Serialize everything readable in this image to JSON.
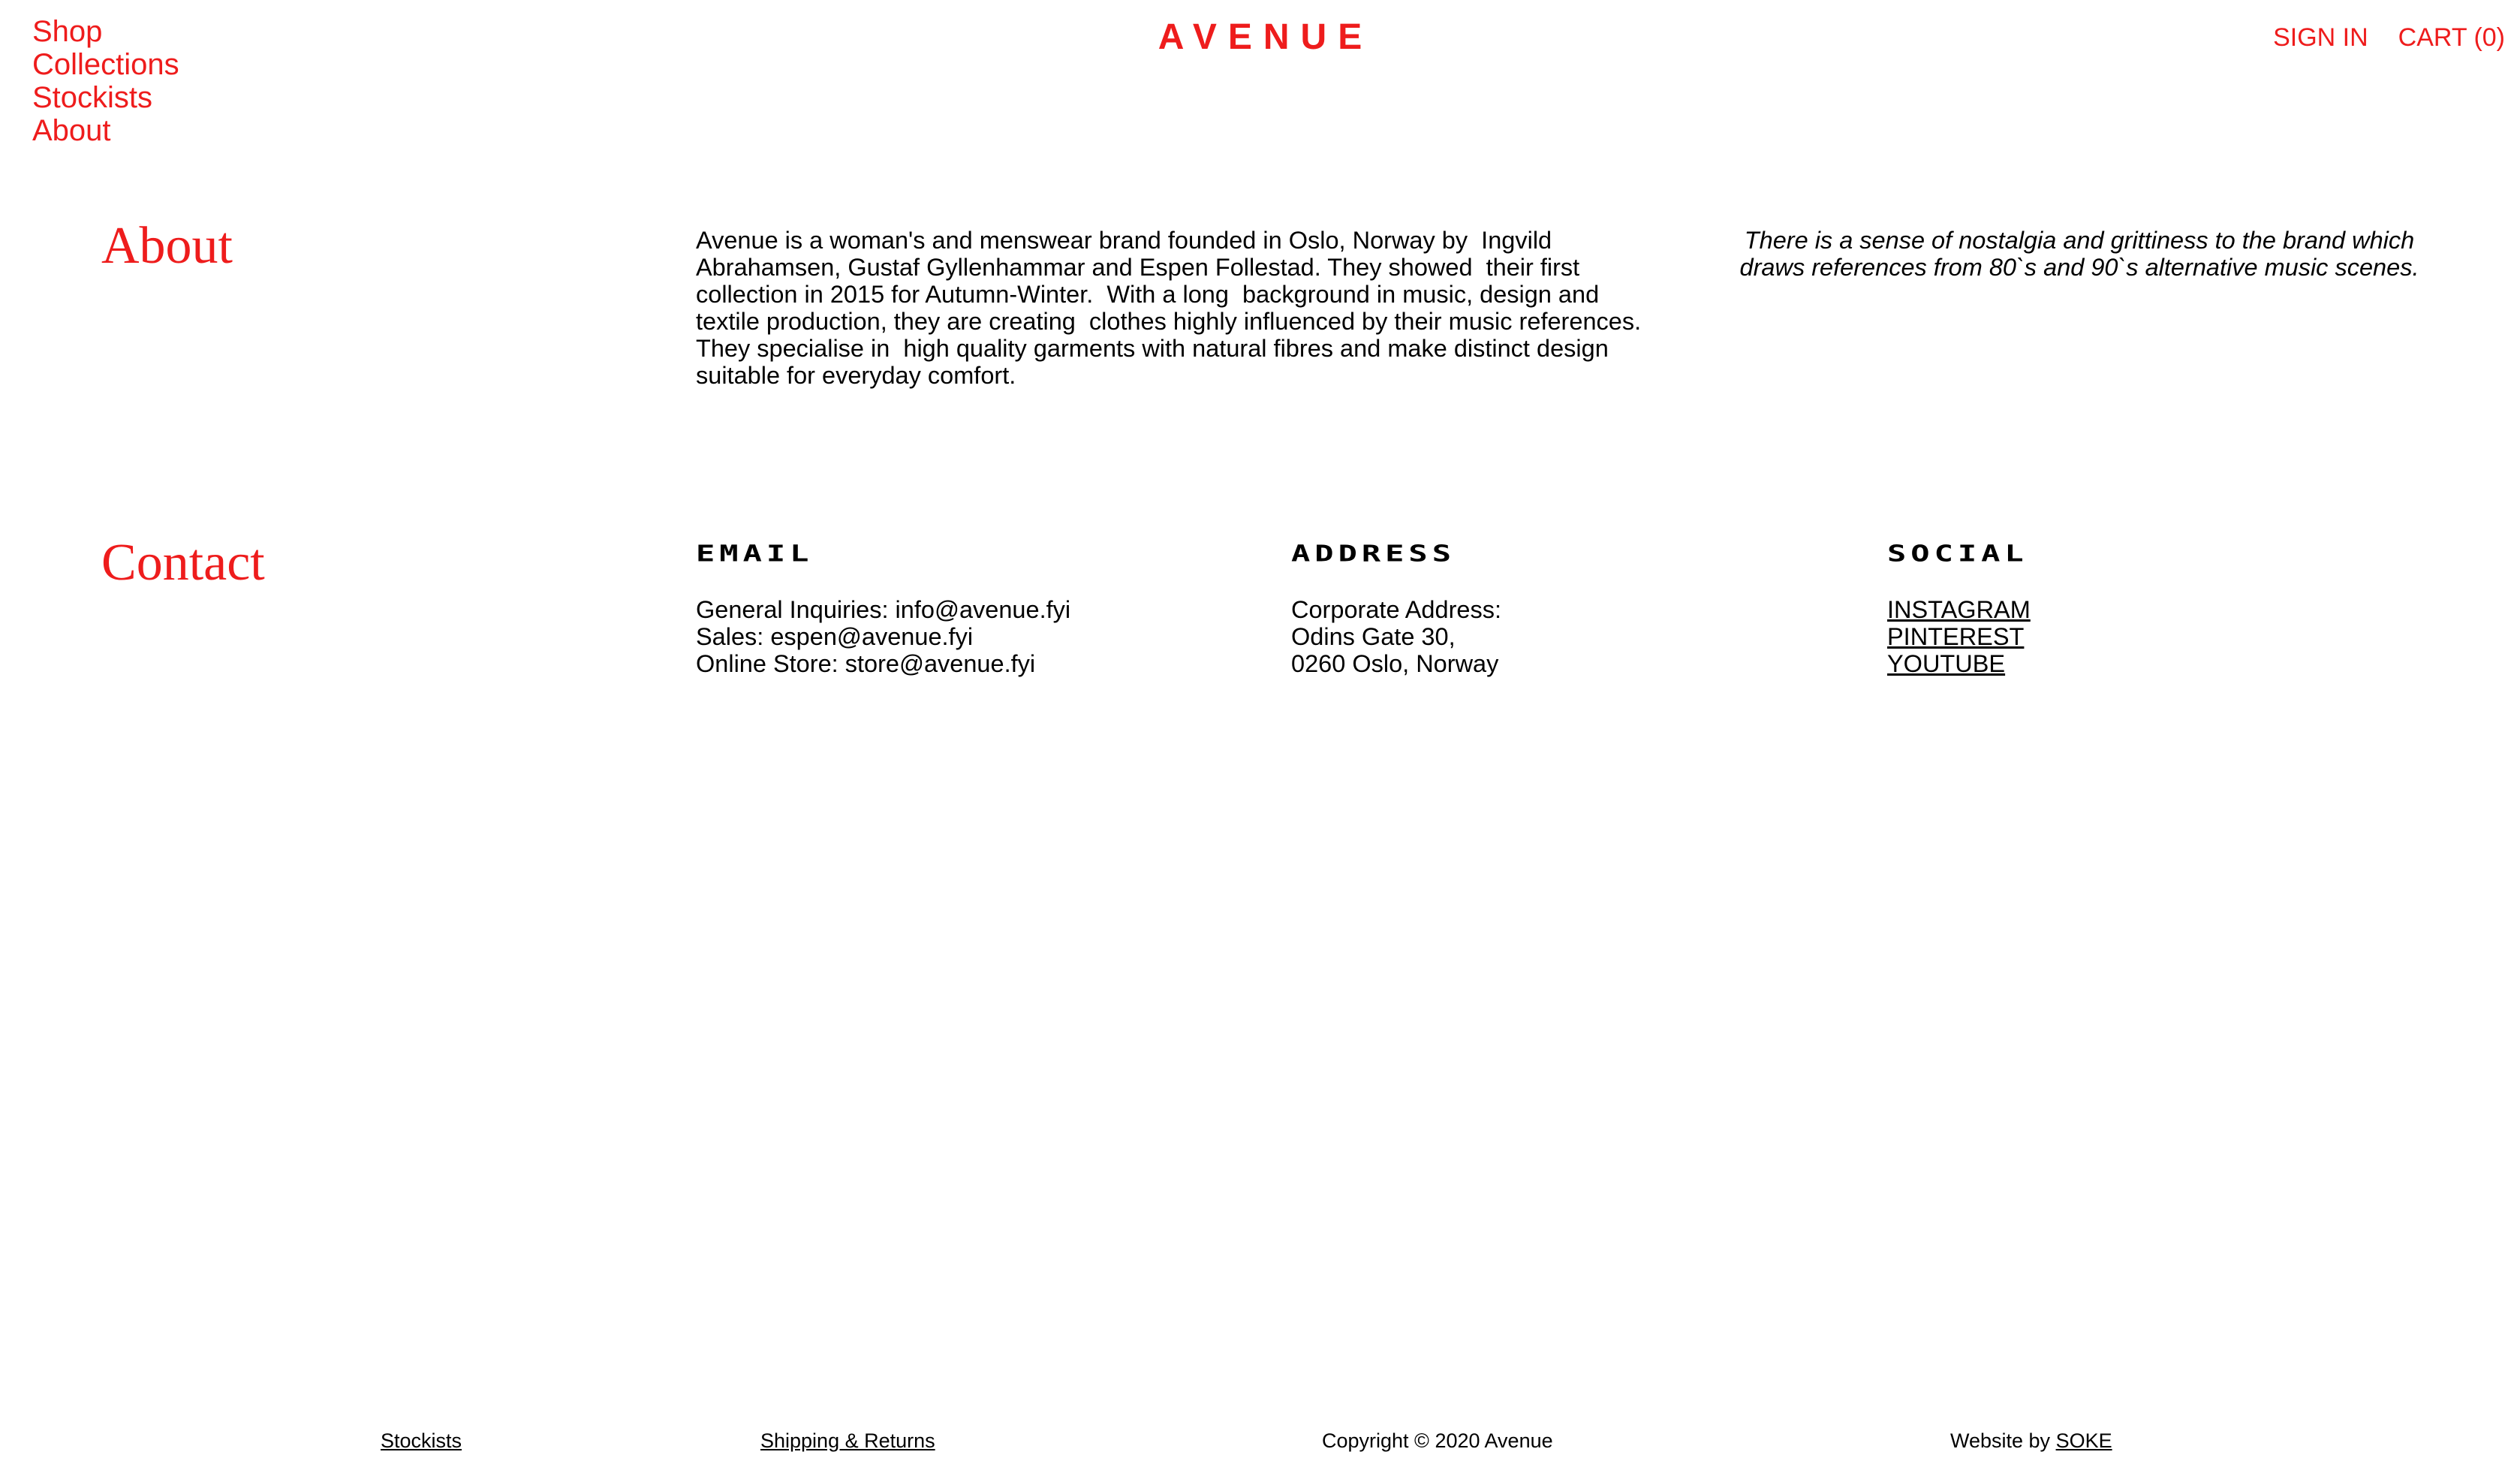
{
  "nav": {
    "items": [
      "Shop",
      "Collections",
      "Stockists",
      "About"
    ]
  },
  "logo": "AVENUE",
  "account": {
    "sign_in": "SIGN IN",
    "cart": "CART (0)"
  },
  "about": {
    "heading": "About",
    "body": "Avenue is a woman's and menswear brand founded in Oslo, Norway by  Ingvild Abrahamsen, Gustaf Gyllenhammar and Espen Follestad. They showed  their first collection in 2015 for Autumn-Winter.  With a long  background in music, design and textile production, they are creating  clothes highly influenced by their music references. They specialise in  high quality garments with natural fibres and make distinct design  suitable for everyday comfort.",
    "quote": "There is a sense of nostalgia and grittiness to the brand which draws references from 80`s and 90`s alternative music scenes."
  },
  "contact": {
    "heading": "Contact",
    "email": {
      "title": "EMAIL",
      "lines": [
        "General Inquiries: info@avenue.fyi",
        "Sales: espen@avenue.fyi",
        "Online Store: store@avenue.fyi"
      ]
    },
    "address": {
      "title": "ADDRESS",
      "lines": [
        "Corporate Address:",
        "Odins Gate 30,",
        "0260 Oslo, Norway"
      ]
    },
    "social": {
      "title": "SOCIAL",
      "links": [
        "INSTAGRAM",
        "PINTEREST",
        "YOUTUBE"
      ]
    }
  },
  "footer": {
    "stockists": "Stockists",
    "shipping": "Shipping & Returns",
    "copyright": "Copyright © 2020 Avenue",
    "credit_prefix": "Website by ",
    "credit_link": "SOKE"
  },
  "colors": {
    "accent": "#ee1c1c",
    "text": "#000000",
    "background": "#ffffff"
  }
}
